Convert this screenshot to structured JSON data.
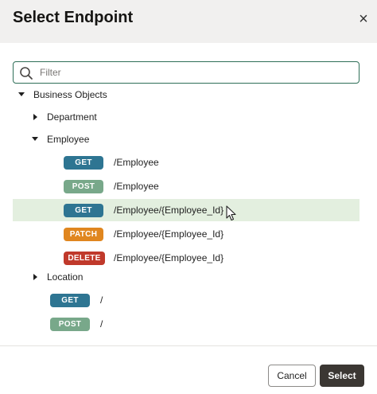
{
  "dialog": {
    "title": "Select Endpoint",
    "close_label": "×"
  },
  "filter": {
    "placeholder": "Filter",
    "value": ""
  },
  "tree": {
    "root": {
      "label": "Business Objects",
      "expanded": true
    },
    "department": {
      "label": "Department",
      "expanded": false
    },
    "employee": {
      "label": "Employee",
      "expanded": true,
      "endpoints": [
        {
          "method": "GET",
          "path": "/Employee"
        },
        {
          "method": "POST",
          "path": "/Employee"
        },
        {
          "method": "GET",
          "path": "/Employee/{Employee_Id}",
          "selected": true
        },
        {
          "method": "PATCH",
          "path": "/Employee/{Employee_Id}"
        },
        {
          "method": "DELETE",
          "path": "/Employee/{Employee_Id}"
        }
      ]
    },
    "location": {
      "label": "Location",
      "expanded": false
    },
    "root_endpoints": [
      {
        "method": "GET",
        "path": "/"
      },
      {
        "method": "POST",
        "path": "/"
      }
    ]
  },
  "footer": {
    "cancel_label": "Cancel",
    "select_label": "Select"
  },
  "colors": {
    "get": "#2e7592",
    "post": "#78a88a",
    "patch": "#e0861f",
    "delete": "#c0392b",
    "selected_row": "#e3efdf",
    "primary_button": "#3b3733"
  }
}
